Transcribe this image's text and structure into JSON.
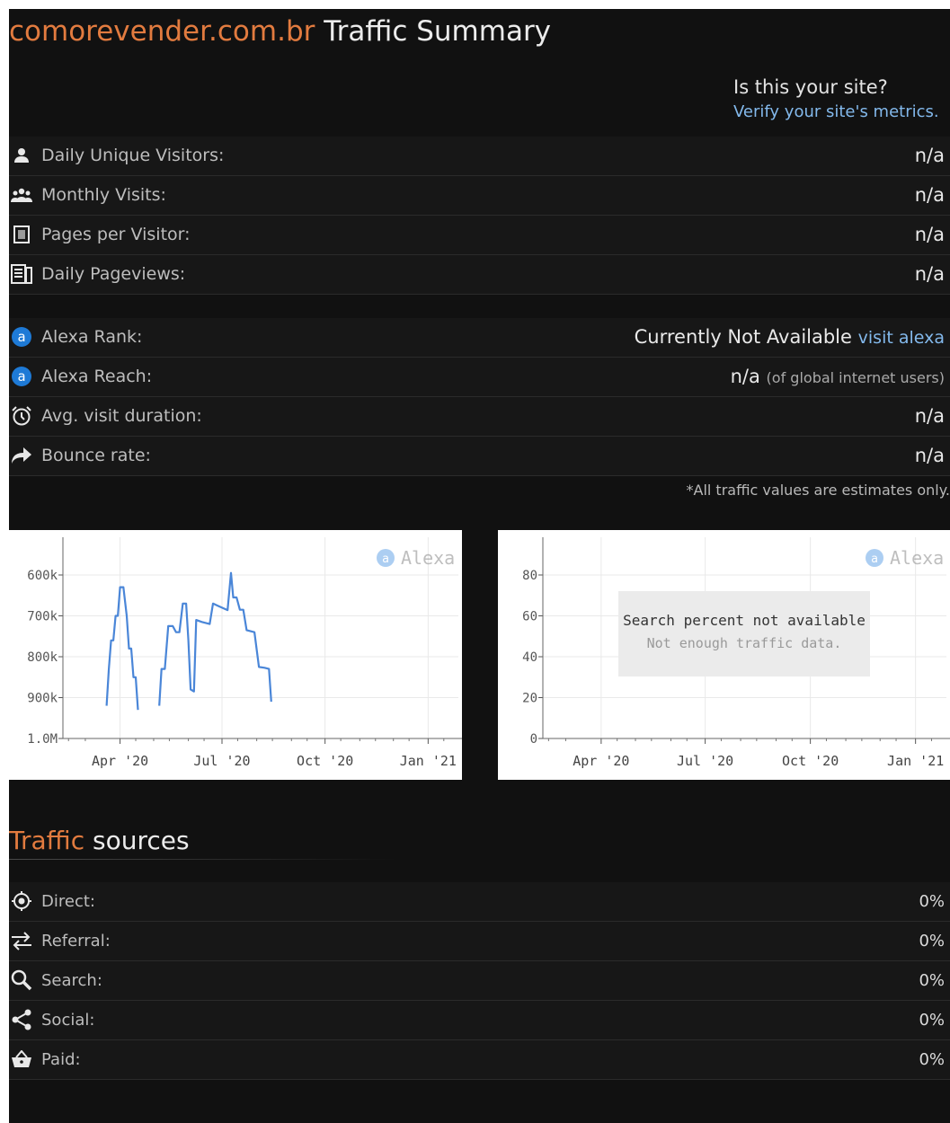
{
  "header": {
    "domain": "comorevender.com.br",
    "title": "Traffic Summary",
    "verify_question": "Is this your site?",
    "verify_link": "Verify your site's metrics."
  },
  "metrics": [
    {
      "icon": "person-icon",
      "label": "Daily Unique Visitors:",
      "value": "n/a"
    },
    {
      "icon": "group-icon",
      "label": "Monthly Visits:",
      "value": "n/a"
    },
    {
      "icon": "page-icon",
      "label": "Pages per Visitor:",
      "value": "n/a"
    },
    {
      "icon": "pages-icon",
      "label": "Daily Pageviews:",
      "value": "n/a"
    }
  ],
  "alexa": {
    "rank_label": "Alexa Rank:",
    "rank_value": "Currently Not Available",
    "rank_link": "visit alexa",
    "reach_label": "Alexa Reach:",
    "reach_value": "n/a",
    "reach_note": "(of global internet users)",
    "duration_label": "Avg. visit duration:",
    "duration_value": "n/a",
    "bounce_label": "Bounce rate:",
    "bounce_value": "n/a"
  },
  "estimates_note": "*All traffic values are estimates only.",
  "chart_data": [
    {
      "type": "line",
      "watermark": "Alexa",
      "y_ticks": [
        "600k",
        "700k",
        "800k",
        "900k",
        "1.0M"
      ],
      "ylim": [
        500000,
        1000000
      ],
      "y_inverted": true,
      "x_ticks": [
        "Apr '20",
        "Jul '20",
        "Oct '20",
        "Jan '21"
      ],
      "xlim": [
        "2020-02-10",
        "2021-01-28"
      ],
      "series": [
        {
          "color": "#4a86d8",
          "segments": [
            [
              [
                "2020-03-20",
                920000
              ],
              [
                "2020-03-22",
                830000
              ],
              [
                "2020-03-24",
                760000
              ],
              [
                "2020-03-26",
                760000
              ],
              [
                "2020-03-28",
                700000
              ],
              [
                "2020-03-30",
                700000
              ],
              [
                "2020-04-01",
                630000
              ],
              [
                "2020-04-04",
                630000
              ],
              [
                "2020-04-07",
                700000
              ],
              [
                "2020-04-09",
                780000
              ],
              [
                "2020-04-11",
                780000
              ],
              [
                "2020-04-13",
                850000
              ],
              [
                "2020-04-15",
                850000
              ],
              [
                "2020-04-17",
                930000
              ]
            ],
            [
              [
                "2020-05-06",
                920000
              ],
              [
                "2020-05-08",
                830000
              ],
              [
                "2020-05-11",
                830000
              ],
              [
                "2020-05-14",
                725000
              ],
              [
                "2020-05-18",
                725000
              ],
              [
                "2020-05-21",
                740000
              ],
              [
                "2020-05-24",
                740000
              ],
              [
                "2020-05-27",
                670000
              ],
              [
                "2020-05-30",
                670000
              ],
              [
                "2020-06-01",
                760000
              ],
              [
                "2020-06-03",
                880000
              ],
              [
                "2020-06-06",
                885000
              ],
              [
                "2020-06-08",
                710000
              ],
              [
                "2020-06-13",
                715000
              ],
              [
                "2020-06-20",
                720000
              ],
              [
                "2020-06-23",
                670000
              ],
              [
                "2020-06-27",
                675000
              ],
              [
                "2020-07-01",
                680000
              ],
              [
                "2020-07-06",
                686000
              ],
              [
                "2020-07-09",
                595000
              ],
              [
                "2020-07-11",
                655000
              ],
              [
                "2020-07-14",
                655000
              ],
              [
                "2020-07-17",
                685000
              ],
              [
                "2020-07-20",
                685000
              ],
              [
                "2020-07-23",
                735000
              ],
              [
                "2020-07-30",
                740000
              ],
              [
                "2020-08-03",
                825000
              ],
              [
                "2020-08-08",
                827000
              ],
              [
                "2020-08-12",
                830000
              ],
              [
                "2020-08-14",
                910000
              ]
            ]
          ]
        }
      ]
    },
    {
      "type": "line",
      "watermark": "Alexa",
      "y_ticks": [
        "80",
        "60",
        "40",
        "20",
        "0"
      ],
      "ylim": [
        0,
        90
      ],
      "x_ticks": [
        "Apr '20",
        "Jul '20",
        "Oct '20",
        "Jan '21"
      ],
      "xlim": [
        "2020-02-10",
        "2021-01-28"
      ],
      "series": [],
      "message_title": "Search percent not available",
      "message_sub": "Not enough traffic data."
    }
  ],
  "traffic_sources": {
    "title_accent": "Traffic",
    "title_rest": " sources",
    "items": [
      {
        "icon": "target-icon",
        "label": "Direct:",
        "value": "0%"
      },
      {
        "icon": "arrows-icon",
        "label": "Referral:",
        "value": "0%"
      },
      {
        "icon": "search-icon",
        "label": "Search:",
        "value": "0%"
      },
      {
        "icon": "share-icon",
        "label": "Social:",
        "value": "0%"
      },
      {
        "icon": "basket-icon",
        "label": "Paid:",
        "value": "0%"
      }
    ]
  }
}
